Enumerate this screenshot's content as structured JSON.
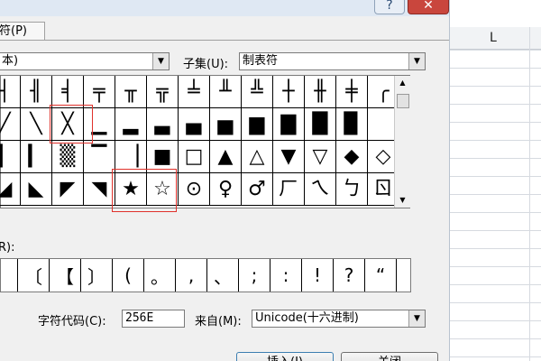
{
  "dialog": {
    "help_glyph": "?",
    "close_glyph": "✕",
    "tab_symbols": "符(P)",
    "font_value": "本)",
    "subset_label": "子集(U):",
    "subset_value": "制表符",
    "recent_label": "R):",
    "code_label": "字符代码(C):",
    "code_value": "256E",
    "from_label": "来自(M):",
    "from_value": "Unicode(十六进制)",
    "insert_label": "插入(I)",
    "cancel_label": "关闭"
  },
  "grid": {
    "rows": [
      [
        "┤",
        "╢",
        "╡",
        "╤",
        "╥",
        "╦",
        "╧",
        "╨",
        "╩",
        "┼",
        "╫",
        "╪",
        "╭"
      ],
      [
        "╱",
        "╲",
        "╳",
        "▁",
        "▂",
        "▃",
        "▄",
        "▅",
        "▆",
        "▇",
        "█",
        "▉",
        ""
      ],
      [
        "▍",
        "▎",
        "▒",
        "▔",
        "▕",
        "■",
        "□",
        "▲",
        "△",
        "▼",
        "▽",
        "◆",
        "◇"
      ],
      [
        "◢",
        "◣",
        "◤",
        "◥",
        "★",
        "☆",
        "⊙",
        "♀",
        "♂",
        "ㄏ",
        "ㄟ",
        "ㄅ",
        "ㄖ"
      ]
    ]
  },
  "recent": [
    "",
    "〔",
    "【",
    "〕",
    "(",
    "。",
    ",",
    "、",
    ";",
    ":",
    "!",
    "?",
    "“"
  ],
  "highlight_color": "#e0312b",
  "excel": {
    "column_header": "L"
  }
}
